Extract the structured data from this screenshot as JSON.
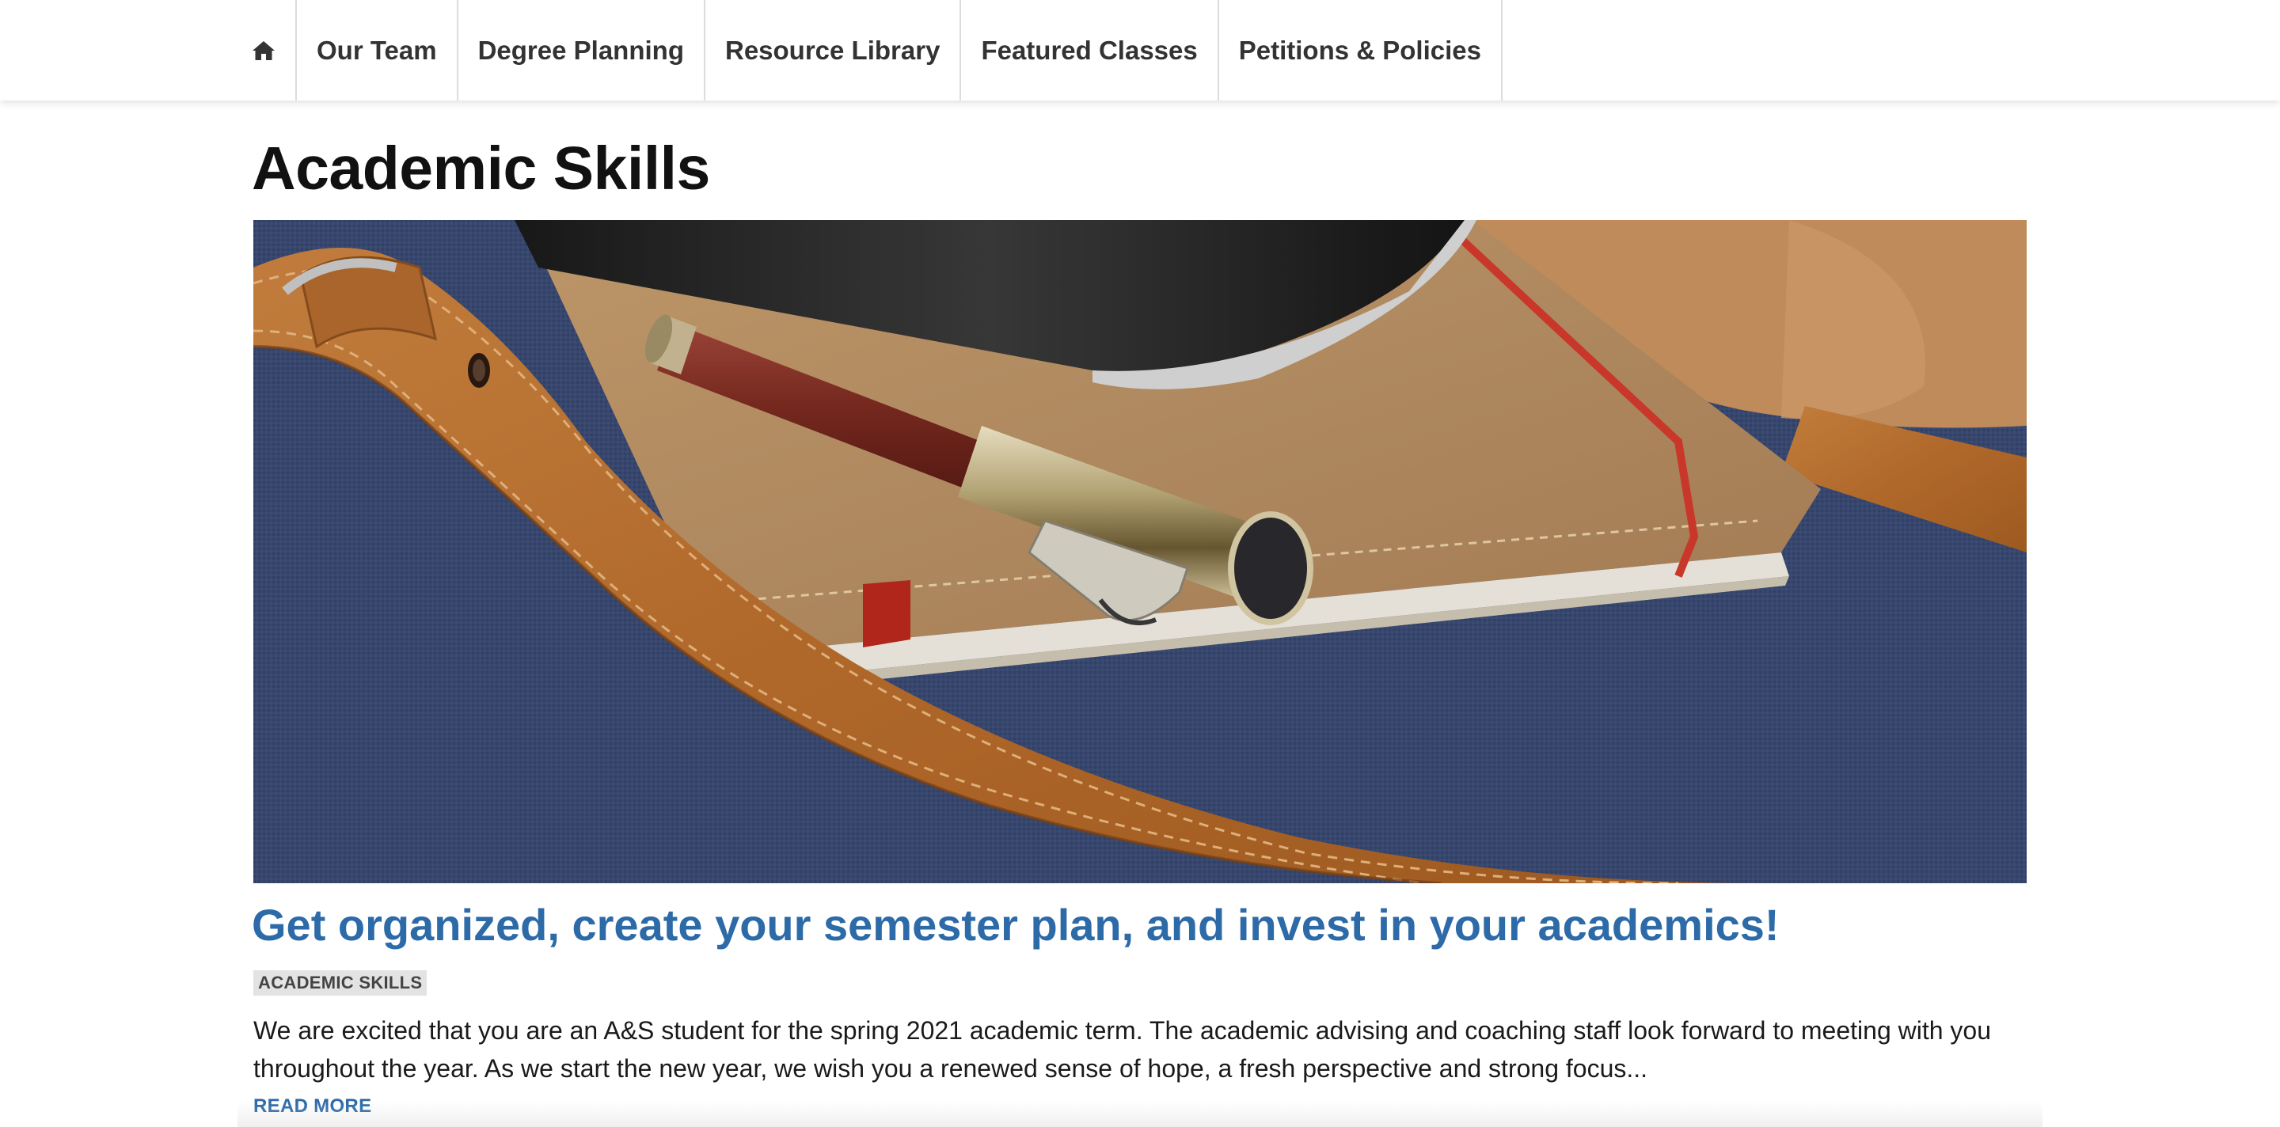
{
  "nav": {
    "home_icon": "home-icon",
    "items": [
      {
        "label": "Our Team"
      },
      {
        "label": "Degree Planning"
      },
      {
        "label": "Resource Library"
      },
      {
        "label": "Featured Classes"
      },
      {
        "label": "Petitions & Policies"
      }
    ]
  },
  "page": {
    "title": "Academic Skills"
  },
  "post": {
    "title": "Get organized, create your semester plan, and invest in your academics!",
    "tag": "ACADEMIC SKILLS",
    "excerpt": "We are excited that you are an A&S student for the spring 2021 academic term. The academic advising and coaching staff look forward to meeting with you throughout the year. As we start the new year, we wish you a renewed sense of hope, a fresh perspective and strong focus...",
    "read_more": "READ MORE"
  },
  "colors": {
    "link": "#2c6aa8",
    "title": "#111111",
    "tag_bg": "#e3e3e3"
  }
}
